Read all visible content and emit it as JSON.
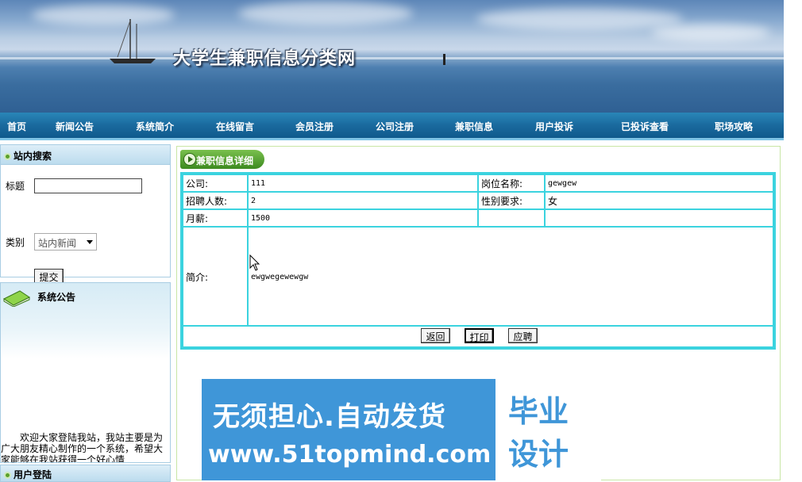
{
  "header": {
    "site_title": "大学生兼职信息分类网"
  },
  "nav": [
    "首页",
    "新闻公告",
    "系统简介",
    "在线留言",
    "会员注册",
    "公司注册",
    "兼职信息",
    "用户投诉",
    "已投诉查看",
    "职场攻略"
  ],
  "sidebar": {
    "search_title": "站内搜索",
    "title_label": "标题",
    "title_value": "",
    "category_label": "类别",
    "category_selected": "站内新闻",
    "submit_label": "提交",
    "notice_title": "系统公告",
    "notice_text": "欢迎大家登陆我站，我站主要是为广大朋友精心制作的一个系统，希望大家能够在我站获得一个好心情",
    "login_title": "用户登陆"
  },
  "detail": {
    "tab_label": "兼职信息详细",
    "company_label": "公司:",
    "company_value": "111",
    "position_label": "岗位名称:",
    "position_value": "gewgew",
    "count_label": "招聘人数:",
    "count_value": "2",
    "gender_label": "性别要求:",
    "gender_value": "女",
    "salary_label": "月薪:",
    "salary_value": "1500",
    "intro_label": "简介:",
    "intro_value": "ewgwegewewgw",
    "back_label": "返回",
    "print_label": "打印",
    "apply_label": "应聘"
  },
  "ad": {
    "slogan": "无须担心.自动发货",
    "url": "www.51topmind.com",
    "badge_line1": "毕业",
    "badge_line2": "设计"
  }
}
